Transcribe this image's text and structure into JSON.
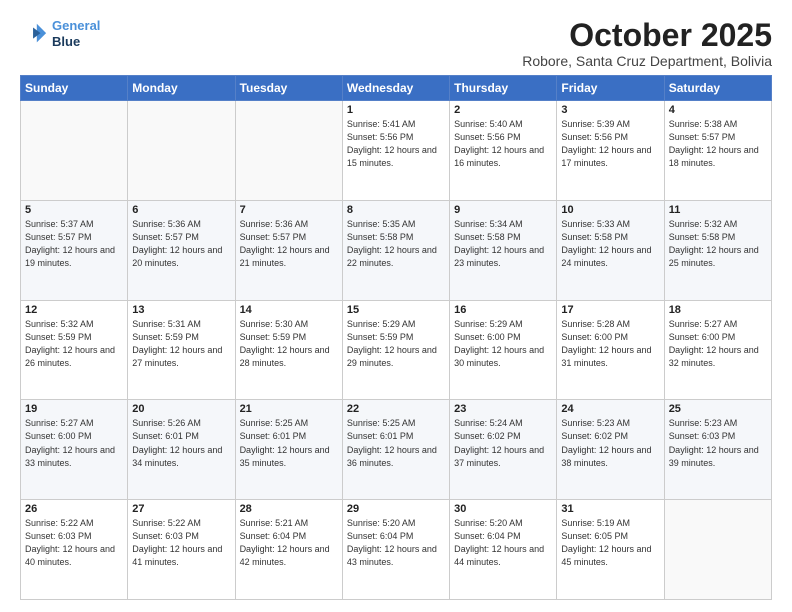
{
  "header": {
    "logo_line1": "General",
    "logo_line2": "Blue",
    "month": "October 2025",
    "location": "Robore, Santa Cruz Department, Bolivia"
  },
  "weekdays": [
    "Sunday",
    "Monday",
    "Tuesday",
    "Wednesday",
    "Thursday",
    "Friday",
    "Saturday"
  ],
  "weeks": [
    [
      {
        "day": "",
        "sunrise": "",
        "sunset": "",
        "daylight": ""
      },
      {
        "day": "",
        "sunrise": "",
        "sunset": "",
        "daylight": ""
      },
      {
        "day": "",
        "sunrise": "",
        "sunset": "",
        "daylight": ""
      },
      {
        "day": "1",
        "sunrise": "Sunrise: 5:41 AM",
        "sunset": "Sunset: 5:56 PM",
        "daylight": "Daylight: 12 hours and 15 minutes."
      },
      {
        "day": "2",
        "sunrise": "Sunrise: 5:40 AM",
        "sunset": "Sunset: 5:56 PM",
        "daylight": "Daylight: 12 hours and 16 minutes."
      },
      {
        "day": "3",
        "sunrise": "Sunrise: 5:39 AM",
        "sunset": "Sunset: 5:56 PM",
        "daylight": "Daylight: 12 hours and 17 minutes."
      },
      {
        "day": "4",
        "sunrise": "Sunrise: 5:38 AM",
        "sunset": "Sunset: 5:57 PM",
        "daylight": "Daylight: 12 hours and 18 minutes."
      }
    ],
    [
      {
        "day": "5",
        "sunrise": "Sunrise: 5:37 AM",
        "sunset": "Sunset: 5:57 PM",
        "daylight": "Daylight: 12 hours and 19 minutes."
      },
      {
        "day": "6",
        "sunrise": "Sunrise: 5:36 AM",
        "sunset": "Sunset: 5:57 PM",
        "daylight": "Daylight: 12 hours and 20 minutes."
      },
      {
        "day": "7",
        "sunrise": "Sunrise: 5:36 AM",
        "sunset": "Sunset: 5:57 PM",
        "daylight": "Daylight: 12 hours and 21 minutes."
      },
      {
        "day": "8",
        "sunrise": "Sunrise: 5:35 AM",
        "sunset": "Sunset: 5:58 PM",
        "daylight": "Daylight: 12 hours and 22 minutes."
      },
      {
        "day": "9",
        "sunrise": "Sunrise: 5:34 AM",
        "sunset": "Sunset: 5:58 PM",
        "daylight": "Daylight: 12 hours and 23 minutes."
      },
      {
        "day": "10",
        "sunrise": "Sunrise: 5:33 AM",
        "sunset": "Sunset: 5:58 PM",
        "daylight": "Daylight: 12 hours and 24 minutes."
      },
      {
        "day": "11",
        "sunrise": "Sunrise: 5:32 AM",
        "sunset": "Sunset: 5:58 PM",
        "daylight": "Daylight: 12 hours and 25 minutes."
      }
    ],
    [
      {
        "day": "12",
        "sunrise": "Sunrise: 5:32 AM",
        "sunset": "Sunset: 5:59 PM",
        "daylight": "Daylight: 12 hours and 26 minutes."
      },
      {
        "day": "13",
        "sunrise": "Sunrise: 5:31 AM",
        "sunset": "Sunset: 5:59 PM",
        "daylight": "Daylight: 12 hours and 27 minutes."
      },
      {
        "day": "14",
        "sunrise": "Sunrise: 5:30 AM",
        "sunset": "Sunset: 5:59 PM",
        "daylight": "Daylight: 12 hours and 28 minutes."
      },
      {
        "day": "15",
        "sunrise": "Sunrise: 5:29 AM",
        "sunset": "Sunset: 5:59 PM",
        "daylight": "Daylight: 12 hours and 29 minutes."
      },
      {
        "day": "16",
        "sunrise": "Sunrise: 5:29 AM",
        "sunset": "Sunset: 6:00 PM",
        "daylight": "Daylight: 12 hours and 30 minutes."
      },
      {
        "day": "17",
        "sunrise": "Sunrise: 5:28 AM",
        "sunset": "Sunset: 6:00 PM",
        "daylight": "Daylight: 12 hours and 31 minutes."
      },
      {
        "day": "18",
        "sunrise": "Sunrise: 5:27 AM",
        "sunset": "Sunset: 6:00 PM",
        "daylight": "Daylight: 12 hours and 32 minutes."
      }
    ],
    [
      {
        "day": "19",
        "sunrise": "Sunrise: 5:27 AM",
        "sunset": "Sunset: 6:00 PM",
        "daylight": "Daylight: 12 hours and 33 minutes."
      },
      {
        "day": "20",
        "sunrise": "Sunrise: 5:26 AM",
        "sunset": "Sunset: 6:01 PM",
        "daylight": "Daylight: 12 hours and 34 minutes."
      },
      {
        "day": "21",
        "sunrise": "Sunrise: 5:25 AM",
        "sunset": "Sunset: 6:01 PM",
        "daylight": "Daylight: 12 hours and 35 minutes."
      },
      {
        "day": "22",
        "sunrise": "Sunrise: 5:25 AM",
        "sunset": "Sunset: 6:01 PM",
        "daylight": "Daylight: 12 hours and 36 minutes."
      },
      {
        "day": "23",
        "sunrise": "Sunrise: 5:24 AM",
        "sunset": "Sunset: 6:02 PM",
        "daylight": "Daylight: 12 hours and 37 minutes."
      },
      {
        "day": "24",
        "sunrise": "Sunrise: 5:23 AM",
        "sunset": "Sunset: 6:02 PM",
        "daylight": "Daylight: 12 hours and 38 minutes."
      },
      {
        "day": "25",
        "sunrise": "Sunrise: 5:23 AM",
        "sunset": "Sunset: 6:03 PM",
        "daylight": "Daylight: 12 hours and 39 minutes."
      }
    ],
    [
      {
        "day": "26",
        "sunrise": "Sunrise: 5:22 AM",
        "sunset": "Sunset: 6:03 PM",
        "daylight": "Daylight: 12 hours and 40 minutes."
      },
      {
        "day": "27",
        "sunrise": "Sunrise: 5:22 AM",
        "sunset": "Sunset: 6:03 PM",
        "daylight": "Daylight: 12 hours and 41 minutes."
      },
      {
        "day": "28",
        "sunrise": "Sunrise: 5:21 AM",
        "sunset": "Sunset: 6:04 PM",
        "daylight": "Daylight: 12 hours and 42 minutes."
      },
      {
        "day": "29",
        "sunrise": "Sunrise: 5:20 AM",
        "sunset": "Sunset: 6:04 PM",
        "daylight": "Daylight: 12 hours and 43 minutes."
      },
      {
        "day": "30",
        "sunrise": "Sunrise: 5:20 AM",
        "sunset": "Sunset: 6:04 PM",
        "daylight": "Daylight: 12 hours and 44 minutes."
      },
      {
        "day": "31",
        "sunrise": "Sunrise: 5:19 AM",
        "sunset": "Sunset: 6:05 PM",
        "daylight": "Daylight: 12 hours and 45 minutes."
      },
      {
        "day": "",
        "sunrise": "",
        "sunset": "",
        "daylight": ""
      }
    ]
  ]
}
